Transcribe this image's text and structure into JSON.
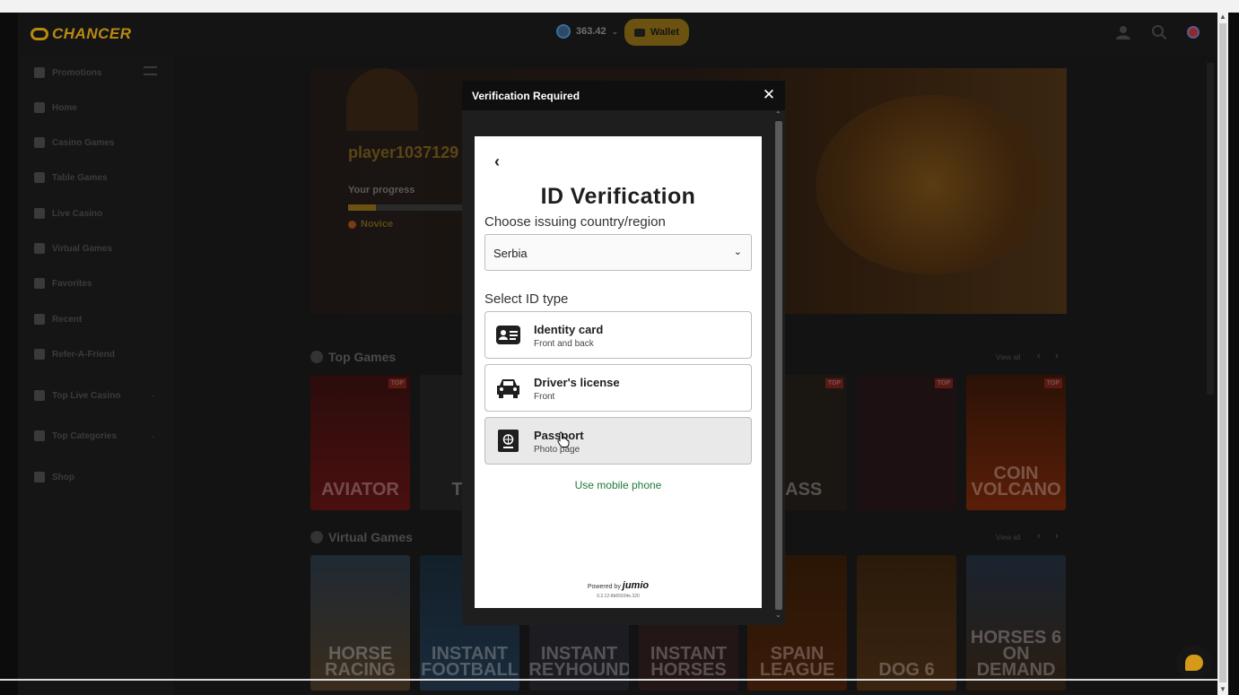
{
  "header": {
    "logo_text": "CHANCER",
    "balance": "363.42",
    "wallet_label": "Wallet"
  },
  "sidebar": {
    "items": [
      {
        "label": "Promotions",
        "icon": "gift-icon"
      },
      {
        "label": "Home",
        "icon": "home-icon"
      },
      {
        "label": "Casino Games",
        "icon": "slot-icon"
      },
      {
        "label": "Table Games",
        "icon": "chip-icon"
      },
      {
        "label": "Live Casino",
        "icon": "dealer-icon"
      },
      {
        "label": "Virtual Games",
        "icon": "horse-icon"
      },
      {
        "label": "Favorites",
        "icon": "heart-icon"
      },
      {
        "label": "Recent",
        "icon": "clock-icon"
      },
      {
        "label": "Refer-A-Friend",
        "icon": "users-icon"
      },
      {
        "label": "Top Live Casino",
        "icon": "tv-icon"
      },
      {
        "label": "Top Categories",
        "icon": "crown-icon"
      },
      {
        "label": "Shop",
        "icon": "cart-icon"
      }
    ]
  },
  "hero": {
    "username": "player1037129",
    "progress_label": "Your progress",
    "progress_value": 0.24,
    "rank": "Novice"
  },
  "sections": {
    "top_games": {
      "title": "Top Games",
      "view_all": "View all",
      "badge": "TOP",
      "tiles": [
        "AVIATOR",
        "THE",
        "",
        "",
        "BASS",
        "",
        "COIN VOLCANO"
      ]
    },
    "virtual_games": {
      "title": "Virtual Games",
      "view_all": "View all",
      "tiles": [
        "HORSE RACING",
        "INSTANT FOOTBALL",
        "INSTANT GREYHOUNDS",
        "INSTANT HORSES",
        "SPAIN LEAGUE",
        "DOG 6",
        "HORSES 6 ON DEMAND"
      ]
    }
  },
  "modal": {
    "title": "Verification Required",
    "close": "✕",
    "verify": {
      "title": "ID Verification",
      "country_label": "Choose issuing country/region",
      "country_value": "Serbia",
      "id_type_label": "Select ID type",
      "options": [
        {
          "main": "Identity card",
          "sub": "Front and back"
        },
        {
          "main": "Driver's license",
          "sub": "Front"
        },
        {
          "main": "Passport",
          "sub": "Photo page"
        }
      ],
      "mobile_link": "Use mobile phone",
      "powered_by": "Powered by",
      "brand": "jumio",
      "version": "0.2.12-8b65934e.320"
    }
  },
  "colors": {
    "accent": "#d49a18",
    "link_green": "#1f7a3a"
  }
}
